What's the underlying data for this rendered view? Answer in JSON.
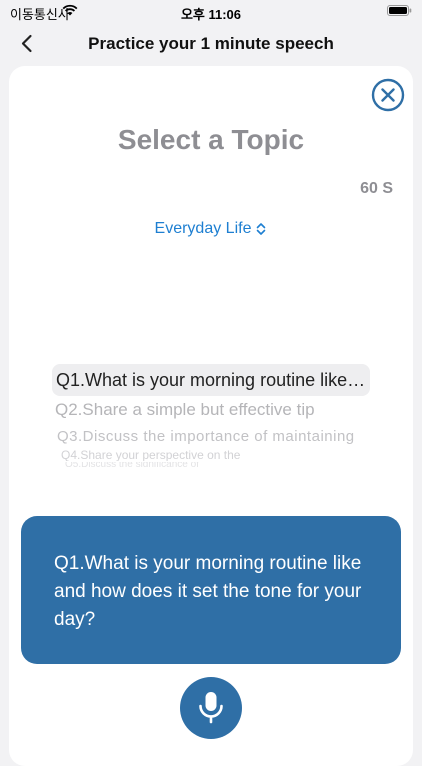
{
  "status_bar": {
    "carrier": "이동통신사",
    "time": "오후 11:06"
  },
  "nav": {
    "title": "Practice your 1 minute speech"
  },
  "sheet": {
    "title": "Select a Topic",
    "timer": "60 S",
    "category": "Everyday Life",
    "questions": [
      "Q1.What is your morning routine like and how does it set the tone for your day?",
      "Q2.Share a simple but effective tip",
      "Q3.Discuss the importance of maintaining",
      "Q4.Share your perspective on the",
      "Q5.Discuss the significance of"
    ],
    "selected_question": "Q1.What is your morning routine like and how does it set the tone for your day?"
  },
  "colors": {
    "accent": "#2f6fa6",
    "link": "#1e7fd1",
    "muted": "#8e8e93"
  },
  "icons": {
    "back": "chevron-left-icon",
    "close": "close-circle-icon",
    "mic": "microphone-icon",
    "updown": "chevron-up-down-icon"
  }
}
